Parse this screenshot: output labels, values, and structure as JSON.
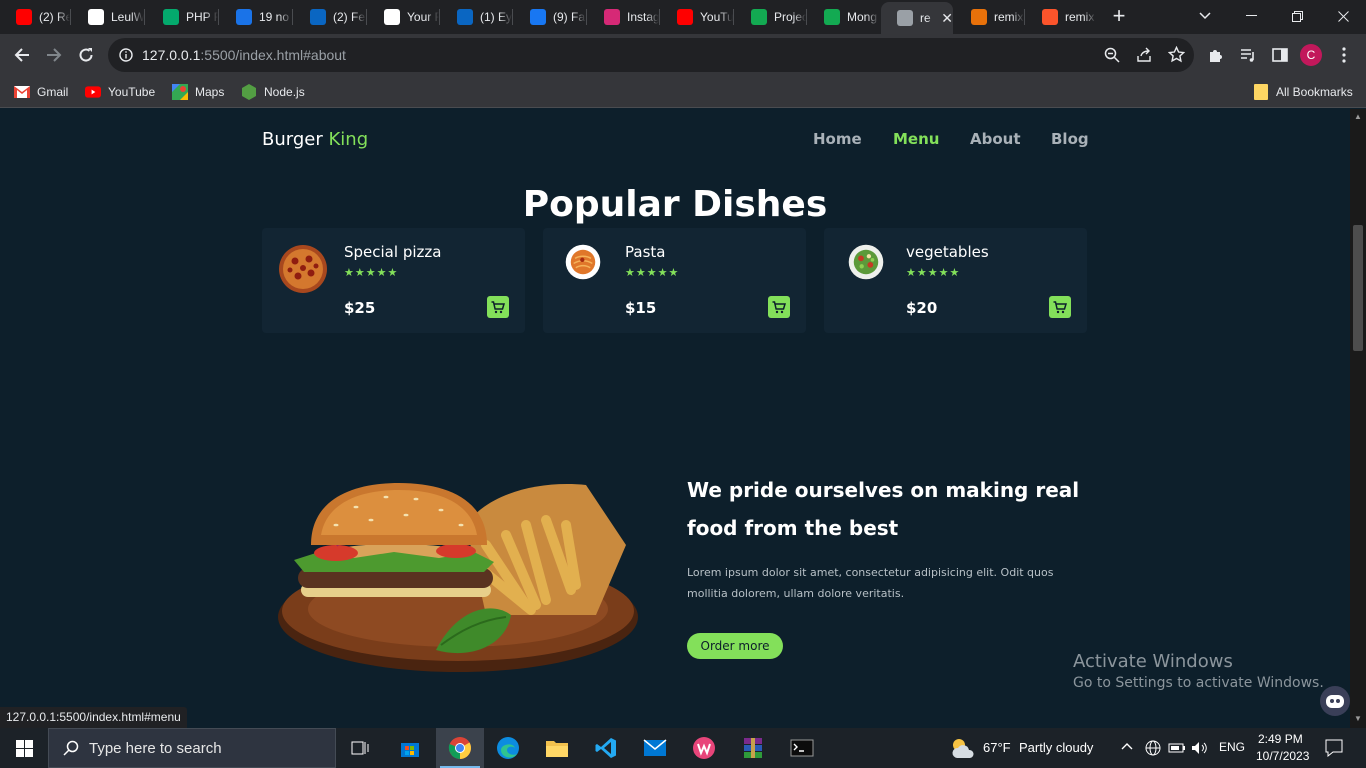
{
  "browser": {
    "tabs": [
      {
        "label": "(2) Re",
        "icon": "youtube-icon",
        "color": "#ff0000"
      },
      {
        "label": "LeulW",
        "icon": "github-icon",
        "color": "#ffffff"
      },
      {
        "label": "PHP F",
        "icon": "w3-icon",
        "color": "#04aa6d"
      },
      {
        "label": "19 no",
        "icon": "badge-19-icon",
        "color": "#1a73e8"
      },
      {
        "label": "(2) Fe",
        "icon": "linkedin-icon",
        "color": "#0a66c2"
      },
      {
        "label": "Your R",
        "icon": "github-icon",
        "color": "#ffffff"
      },
      {
        "label": "(1) Ey",
        "icon": "linkedin-icon",
        "color": "#0a66c2"
      },
      {
        "label": "(9) Fa",
        "icon": "facebook-icon",
        "color": "#1877f2"
      },
      {
        "label": "Instag",
        "icon": "instagram-icon",
        "color": "#d62976"
      },
      {
        "label": "YouTu",
        "icon": "youtube-icon",
        "color": "#ff0000"
      },
      {
        "label": "Projec",
        "icon": "mongodb-leaf-icon",
        "color": "#13aa52"
      },
      {
        "label": "Mong",
        "icon": "mongodb-leaf-icon",
        "color": "#13aa52"
      },
      {
        "label": "re",
        "icon": "globe-icon",
        "color": "#9aa0a6",
        "active": true
      },
      {
        "label": "remix",
        "icon": "code-icon",
        "color": "#e8710a"
      },
      {
        "label": "remix",
        "icon": "brave-icon",
        "color": "#fb542b"
      }
    ],
    "url_host": "127.0.0.1",
    "url_rest": ":5500/index.html#about",
    "avatar_letter": "C",
    "bookmarks": [
      {
        "label": "Gmail",
        "icon": "gmail-icon"
      },
      {
        "label": "YouTube",
        "icon": "youtube-icon"
      },
      {
        "label": "Maps",
        "icon": "maps-icon"
      },
      {
        "label": "Node.js",
        "icon": "nodejs-icon"
      }
    ],
    "all_bookmarks": "All Bookmarks",
    "status_url": "127.0.0.1:5500/index.html#menu"
  },
  "site": {
    "logo_main": "Burger",
    "logo_accent": "King",
    "nav": [
      "Home",
      "Menu",
      "About",
      "Blog"
    ],
    "nav_active": "Menu",
    "section_title": "Popular Dishes",
    "dishes": [
      {
        "name": "Special pizza",
        "stars": "★★★★★",
        "price": "$25",
        "image": "pizza"
      },
      {
        "name": "Pasta",
        "stars": "★★★★★",
        "price": "$15",
        "image": "pasta"
      },
      {
        "name": "vegetables",
        "stars": "★★★★★",
        "price": "$20",
        "image": "salad"
      }
    ],
    "about_heading": "We pride ourselves on making real food from the best",
    "about_text": "Lorem ipsum dolor sit amet, consectetur adipisicing elit. Odit quos mollitia dolorem, ullam dolore veritatis.",
    "order_button": "Order more",
    "colors": {
      "accent": "#83e05a",
      "background": "#0d1f2b",
      "card": "#122533"
    }
  },
  "watermark": {
    "line1": "Activate Windows",
    "line2": "Go to Settings to activate Windows."
  },
  "taskbar": {
    "search_placeholder": "Type here to search",
    "weather_temp": "67°F",
    "weather_desc": "Partly cloudy",
    "language": "ENG",
    "time": "2:49 PM",
    "date": "10/7/2023"
  }
}
